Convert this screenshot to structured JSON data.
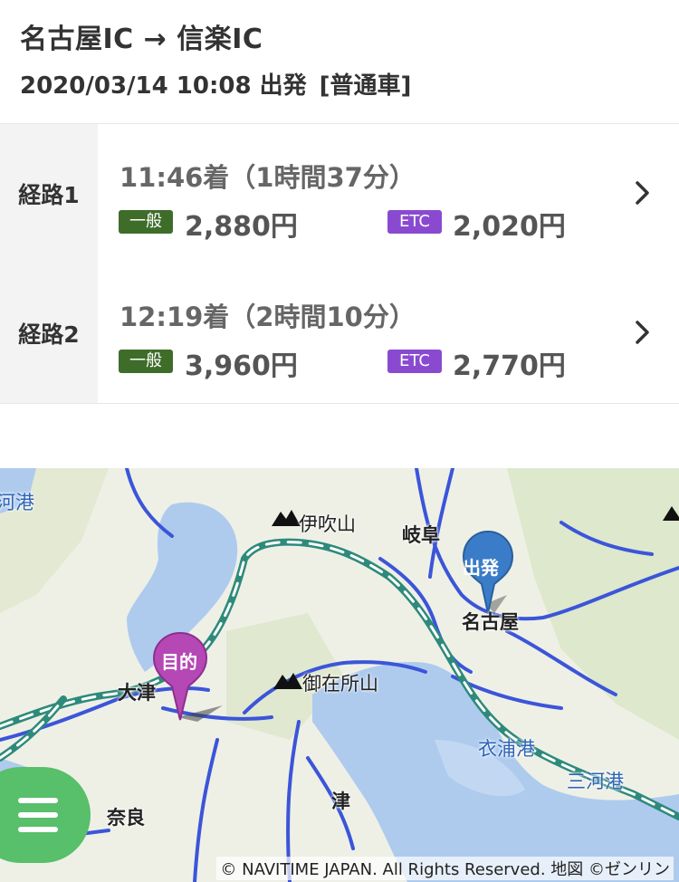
{
  "header": {
    "title": "名古屋IC → 信楽IC",
    "datetime": "2020/03/14 10:08 出発",
    "vehicle": "[普通車]"
  },
  "routes": [
    {
      "label": "経路1",
      "arrival": "11:46着（1時間37分）",
      "general_badge": "一般",
      "general_price": "2,880円",
      "etc_badge": "ETC",
      "etc_price": "2,020円"
    },
    {
      "label": "経路2",
      "arrival": "12:19着（2時間10分）",
      "general_badge": "一般",
      "general_price": "3,960円",
      "etc_badge": "ETC",
      "etc_price": "2,770円"
    }
  ],
  "map": {
    "labels": {
      "ibukiyama": "伊吹山",
      "gifu": "岐阜",
      "nagoya": "名古屋",
      "otsu": "大津",
      "gozaisho": "御在所山",
      "kinuura": "衣浦港",
      "mikawa": "三河港",
      "tsu": "津",
      "nara": "奈良",
      "kou": "河港"
    },
    "start_pin": "出発",
    "dest_pin": "目的",
    "credit": "© NAVITIME JAPAN. All Rights Reserved. 地図 ©ゼンリン"
  },
  "colors": {
    "general_badge": "#3e6d2a",
    "etc_badge": "#8a4ad0",
    "start_pin": "#3a7cc8",
    "dest_pin": "#b548b5",
    "menu_button": "#58bf6a"
  }
}
